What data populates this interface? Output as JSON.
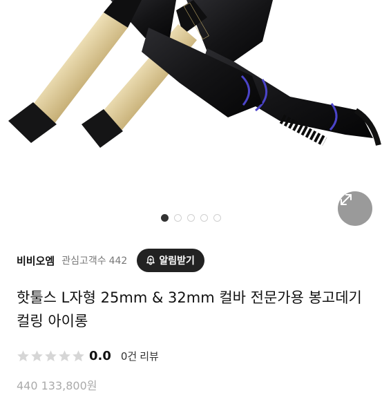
{
  "gallery": {
    "image_alt": "핫툴스 L자형 봉고데기 제품 이미지",
    "dot_count": 5,
    "active_dot": 0
  },
  "store": {
    "name": "비비오엠",
    "followers_label": "관심고객수",
    "followers_count": "442",
    "alarm_button_label": "알림받기"
  },
  "product": {
    "title": "핫툴스 L자형 25mm & 32mm 컬바 전문가용 봉고데기 컬링 아이롱"
  },
  "rating": {
    "stars_filled": 0,
    "stars_total": 5,
    "score": "0.0",
    "review_count": "0건",
    "review_label": "리뷰"
  },
  "price": {
    "partial_text": "440  133,800원"
  },
  "colors": {
    "barrel_gold": "#c9b27a",
    "handle_black": "#1c1c1f",
    "accent_purple": "#5a4fcf",
    "star_empty": "#d6d6d6",
    "alarm_bg": "#222222"
  }
}
